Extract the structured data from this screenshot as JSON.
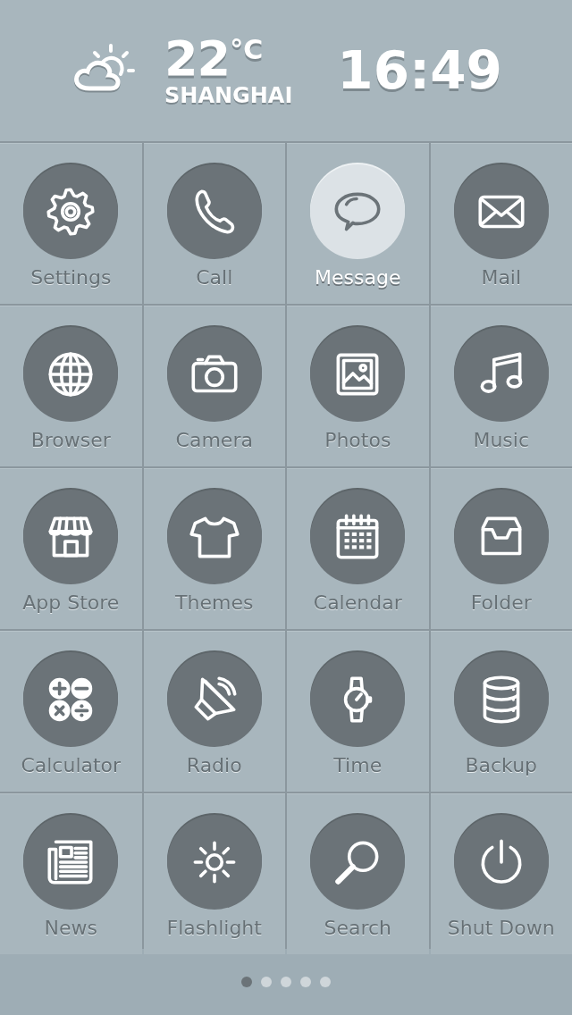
{
  "header": {
    "temperature": "22$^{°C}$",
    "city": "SHANGHAI",
    "time": "16:49"
  },
  "apps": [
    {
      "label": "Settings",
      "kind": "gear",
      "selected": false
    },
    {
      "label": "Call",
      "kind": "phone",
      "selected": false
    },
    {
      "label": "Message",
      "kind": "chat",
      "selected": true
    },
    {
      "label": "Mail",
      "kind": "mail",
      "selected": false
    },
    {
      "label": "Browser",
      "kind": "globe",
      "selected": false
    },
    {
      "label": "Camera",
      "kind": "camera",
      "selected": false
    },
    {
      "label": "Photos",
      "kind": "photo",
      "selected": false
    },
    {
      "label": "Music",
      "kind": "music",
      "selected": false
    },
    {
      "label": "App Store",
      "kind": "store",
      "selected": false
    },
    {
      "label": "Themes",
      "kind": "shirt",
      "selected": false
    },
    {
      "label": "Calendar",
      "kind": "calendar",
      "selected": false
    },
    {
      "label": "Folder",
      "kind": "tray",
      "selected": false
    },
    {
      "label": "Calculator",
      "kind": "calculator",
      "selected": false
    },
    {
      "label": "Radio",
      "kind": "speaker",
      "selected": false
    },
    {
      "label": "Time",
      "kind": "watch",
      "selected": false
    },
    {
      "label": "Backup",
      "kind": "database",
      "selected": false
    },
    {
      "label": "News",
      "kind": "news",
      "selected": false
    },
    {
      "label": "Flashlight",
      "kind": "sun",
      "selected": false
    },
    {
      "label": "Search",
      "kind": "search",
      "selected": false
    },
    {
      "label": "Shut Down",
      "kind": "power",
      "selected": false
    }
  ],
  "pages": [
    {
      "selected": true
    },
    {
      "selected": false
    },
    {
      "selected": false
    },
    {
      "selected": false
    },
    {
      "selected": false
    }
  ]
}
